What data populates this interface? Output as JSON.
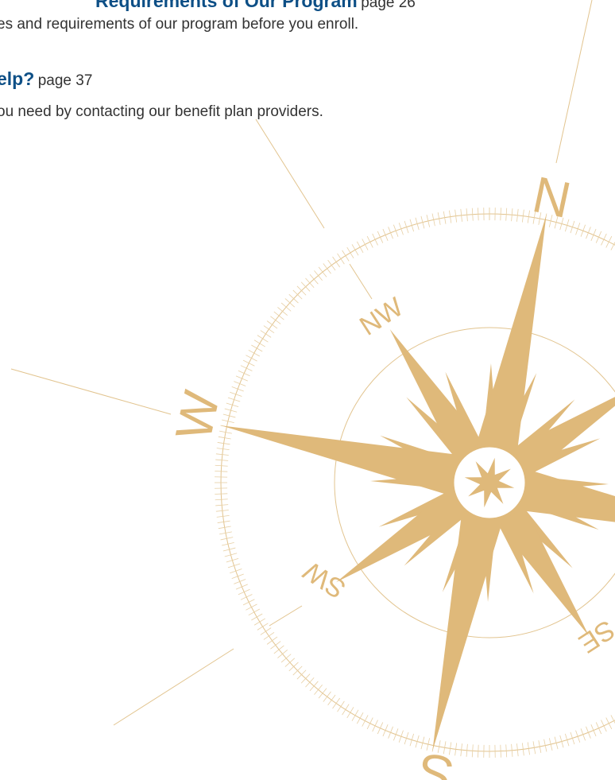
{
  "toc": [
    {
      "title": "Requirements of Our Program",
      "page": "page 26",
      "description": "es and requirements of our program before you enroll."
    },
    {
      "title": "elp?",
      "page": "page 37",
      "description": "ou need by contacting our benefit plan providers."
    }
  ],
  "compass": {
    "labels": {
      "north": "N",
      "northwest": "NW",
      "west": "W",
      "southwest": "SW",
      "south": "S",
      "southeast": "SE"
    },
    "color": "#dfb97a",
    "line_color": "#e2c48f"
  }
}
